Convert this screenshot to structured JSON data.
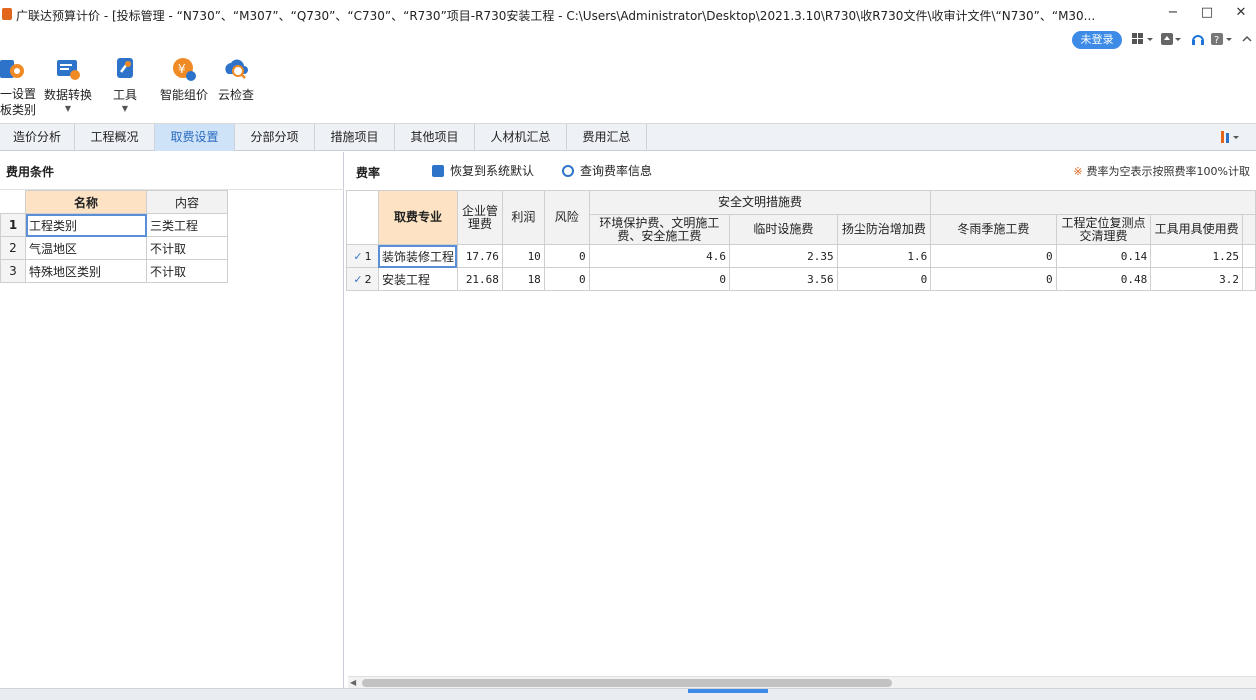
{
  "window": {
    "title": "广联达预算计价 - [投标管理 - “N730”、“M307”、“Q730”、“C730”、“R730”项目-R730安装工程 - C:\\Users\\Administrator\\Desktop\\2021.3.10\\R730\\收R730文件\\收审计文件\\“N730”、“M30...",
    "minimize": "−",
    "maximize": "□",
    "close": "✕"
  },
  "account": {
    "login_label": "未登录"
  },
  "ribbon": {
    "items": [
      {
        "label": "一设置\n板类别",
        "icon": "settings-icon"
      },
      {
        "label": "数据转换",
        "icon": "data-convert-icon"
      },
      {
        "label": "工具",
        "icon": "tools-icon"
      },
      {
        "label": "智能组价",
        "icon": "smart-pricing-icon"
      },
      {
        "label": "云检查",
        "icon": "cloud-check-icon"
      }
    ]
  },
  "tabs": [
    "造价分析",
    "工程概况",
    "取费设置",
    "分部分项",
    "措施项目",
    "其他项目",
    "人材机汇总",
    "费用汇总"
  ],
  "active_tab": "取费设置",
  "left": {
    "title": "费用条件",
    "headers": [
      "名称",
      "内容"
    ],
    "rows": [
      {
        "n": "1",
        "name": "工程类别",
        "value": "三类工程"
      },
      {
        "n": "2",
        "name": "气温地区",
        "value": "不计取"
      },
      {
        "n": "3",
        "name": "特殊地区类别",
        "value": "不计取"
      }
    ]
  },
  "right": {
    "title": "费率",
    "restore_label": "恢复到系统默认",
    "query_label": "查询费率信息",
    "note": "费率为空表示按照费率100%计取",
    "group_header": "安全文明措施费",
    "headers": {
      "major": "取费专业",
      "mgmt": "企业管理费",
      "profit": "利润",
      "risk": "风险",
      "env": "环境保护费、文明施工费、安全施工费",
      "temp": "临时设施费",
      "dust": "扬尘防治增加费",
      "winter": "冬雨季施工费",
      "survey": "工程定位复测点交清理费",
      "tools": "工具用具使用费"
    },
    "rows": [
      {
        "n": "1",
        "major": "装饰装修工程",
        "mgmt": "17.76",
        "profit": "10",
        "risk": "0",
        "env": "4.6",
        "temp": "2.35",
        "dust": "1.6",
        "winter": "0",
        "survey": "0.14",
        "tools": "1.25"
      },
      {
        "n": "2",
        "major": "安装工程",
        "mgmt": "21.68",
        "profit": "18",
        "risk": "0",
        "env": "0",
        "temp": "3.56",
        "dust": "0",
        "winter": "0",
        "survey": "0.48",
        "tools": "3.2"
      }
    ]
  }
}
